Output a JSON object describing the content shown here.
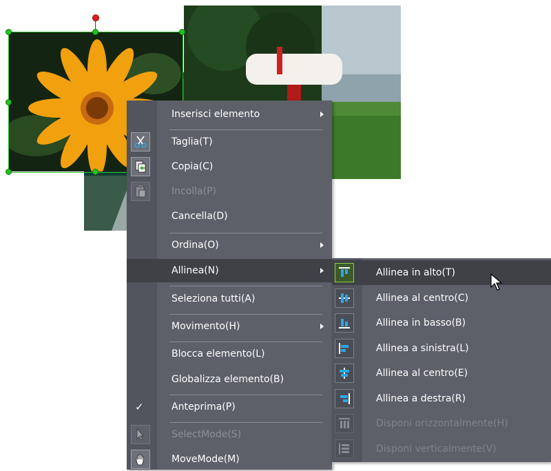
{
  "menu": {
    "items": [
      {
        "label": "Inserisci elemento",
        "submenu": true
      },
      {
        "label": "Taglia(T)",
        "icon": "scissors-icon"
      },
      {
        "label": "Copia(C)",
        "icon": "copy-icon"
      },
      {
        "label": "Incolla(P)",
        "icon": "paste-icon",
        "disabled": true
      },
      {
        "label": "Cancella(D)"
      },
      {
        "label": "Ordina(O)",
        "submenu": true
      },
      {
        "label": "Allinea(N)",
        "submenu": true,
        "highlighted": true
      },
      {
        "label": "Seleziona tutti(A)"
      },
      {
        "label": "Movimento(H)",
        "submenu": true
      },
      {
        "label": "Blocca elemento(L)"
      },
      {
        "label": "Globalizza elemento(B)"
      },
      {
        "label": "Anteprima(P)",
        "checked": true,
        "check_glyph": "✓"
      },
      {
        "label": "SelectMode(S)",
        "icon": "arrow-pointer-icon",
        "disabled": true
      },
      {
        "label": "MoveMode(M)",
        "icon": "hand-icon"
      }
    ]
  },
  "submenu": {
    "items": [
      {
        "label": "Allinea in alto(T)",
        "icon": "align-top-icon",
        "highlighted": true
      },
      {
        "label": "Allinea al centro(C)",
        "icon": "align-vertical-center-icon"
      },
      {
        "label": "Allinea in basso(B)",
        "icon": "align-bottom-icon"
      },
      {
        "label": "Allinea a sinistra(L)",
        "icon": "align-left-icon"
      },
      {
        "label": "Allinea al centro(E)",
        "icon": "align-horizontal-center-icon"
      },
      {
        "label": "Allinea a destra(R)",
        "icon": "align-right-icon"
      },
      {
        "label": "Disponi orizzontalmente(H)",
        "icon": "distribute-horizontal-icon",
        "disabled": true
      },
      {
        "label": "Disponi verticalmente(V)",
        "icon": "distribute-vertical-icon",
        "disabled": true
      }
    ]
  },
  "colors": {
    "menu_bg": "#5d6069",
    "highlight": "#3f4147",
    "selection": "#26c026",
    "rotate_handle": "#e02020",
    "accent_icon": "#2aa7e6"
  }
}
